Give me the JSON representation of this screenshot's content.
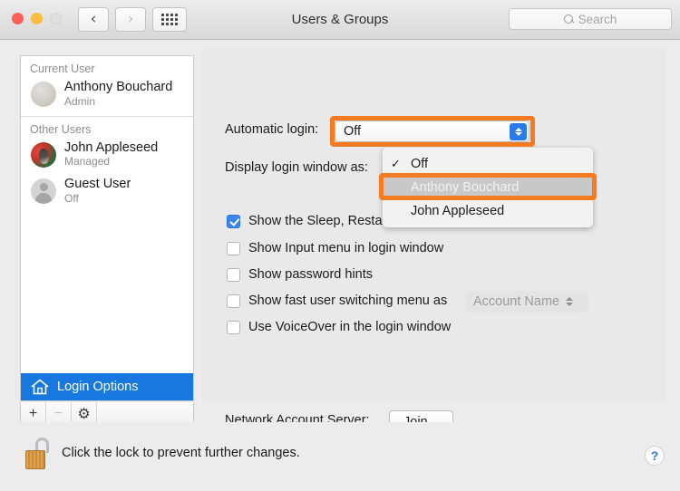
{
  "window": {
    "title": "Users & Groups",
    "traffic_lights": [
      "close",
      "minimize",
      "zoom"
    ],
    "nav": {
      "back": "‹",
      "forward": "›",
      "grid": "show-all-icon"
    },
    "search": {
      "placeholder": "Search",
      "value": ""
    }
  },
  "sidebar": {
    "groups": [
      {
        "header": "Current User",
        "users": [
          {
            "name": "Anthony Bouchard",
            "status": "Admin",
            "avatar": "blank"
          }
        ]
      },
      {
        "header": "Other Users",
        "users": [
          {
            "name": "John Appleseed",
            "status": "Managed",
            "avatar": "photo"
          },
          {
            "name": "Guest User",
            "status": "Off",
            "avatar": "silhouette"
          }
        ]
      }
    ],
    "selected_item": {
      "label": "Login Options",
      "icon": "house-icon"
    },
    "toolbar": {
      "add": "+",
      "remove": "−",
      "settings": "⚙"
    }
  },
  "main": {
    "automatic_login": {
      "label": "Automatic login:",
      "value": "Off",
      "menu_open": true,
      "options": [
        {
          "label": "Off",
          "checked": true,
          "highlighted": false
        },
        {
          "label": "Anthony Bouchard",
          "checked": false,
          "highlighted": true
        },
        {
          "label": "John Appleseed",
          "checked": false,
          "highlighted": false
        }
      ]
    },
    "display_login_window": {
      "label": "Display login window as:"
    },
    "checkboxes": [
      {
        "label": "Show the Sleep, Restart, and Shut Down buttons",
        "checked": true
      },
      {
        "label": "Show Input menu in login window",
        "checked": false
      },
      {
        "label": "Show password hints",
        "checked": false
      },
      {
        "label": "Show fast user switching menu as",
        "checked": false
      },
      {
        "label": "Use VoiceOver in the login window",
        "checked": false
      }
    ],
    "fast_user_switching": {
      "value": "Account Name",
      "disabled": true
    },
    "network_account_server": {
      "label": "Network Account Server:",
      "button": "Join..."
    }
  },
  "footer": {
    "lock": {
      "icon": "unlocked-padlock-icon",
      "text": "Click the lock to prevent further changes."
    },
    "help": "?"
  },
  "annotations": {
    "accent_color": "#f47b20",
    "boxes": [
      "automatic-login-popup",
      "menu-option-anthony-bouchard"
    ]
  }
}
